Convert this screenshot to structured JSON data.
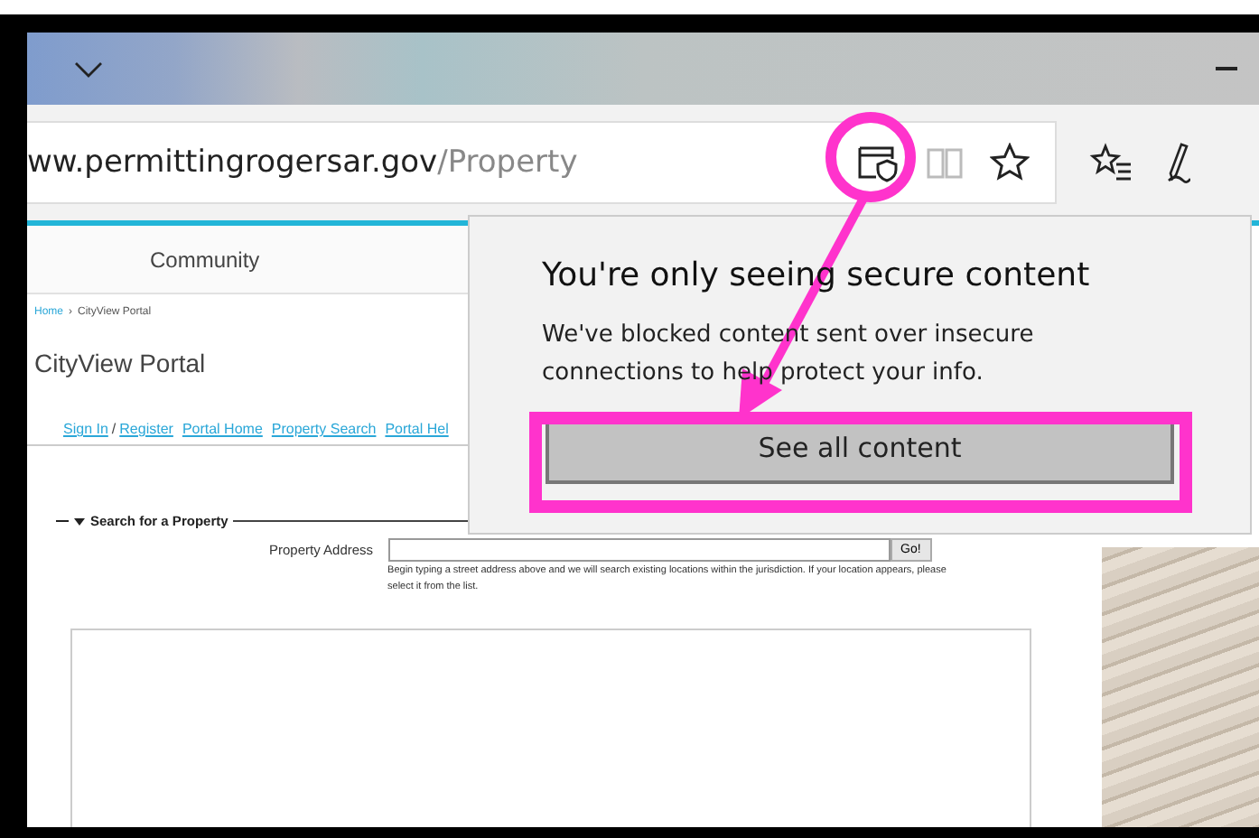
{
  "browser": {
    "url_host": "ww.permittingrogersar.gov",
    "url_path": "/Property"
  },
  "page": {
    "nav_item": "Community",
    "breadcrumb": [
      "Home",
      "CityView Portal"
    ],
    "breadcrumb_separator": "›",
    "title": "CityView Portal",
    "links": [
      {
        "label": "Sign In"
      },
      {
        "label": "/",
        "kind": "separator"
      },
      {
        "label": "Register"
      },
      {
        "label": "Portal Home"
      },
      {
        "label": "Property Search"
      },
      {
        "label": "Portal Hel"
      }
    ],
    "section_title": "Search for a Property",
    "field_label": "Property Address",
    "go_button": "Go!",
    "hint": "Begin typing a street address above and we will search existing locations within the jurisdiction. If your location appears, please select it from the list."
  },
  "popup": {
    "title": "You're only seeing secure content",
    "message": "We've blocked content sent over insecure connections to help protect your info.",
    "button": "See all content"
  }
}
